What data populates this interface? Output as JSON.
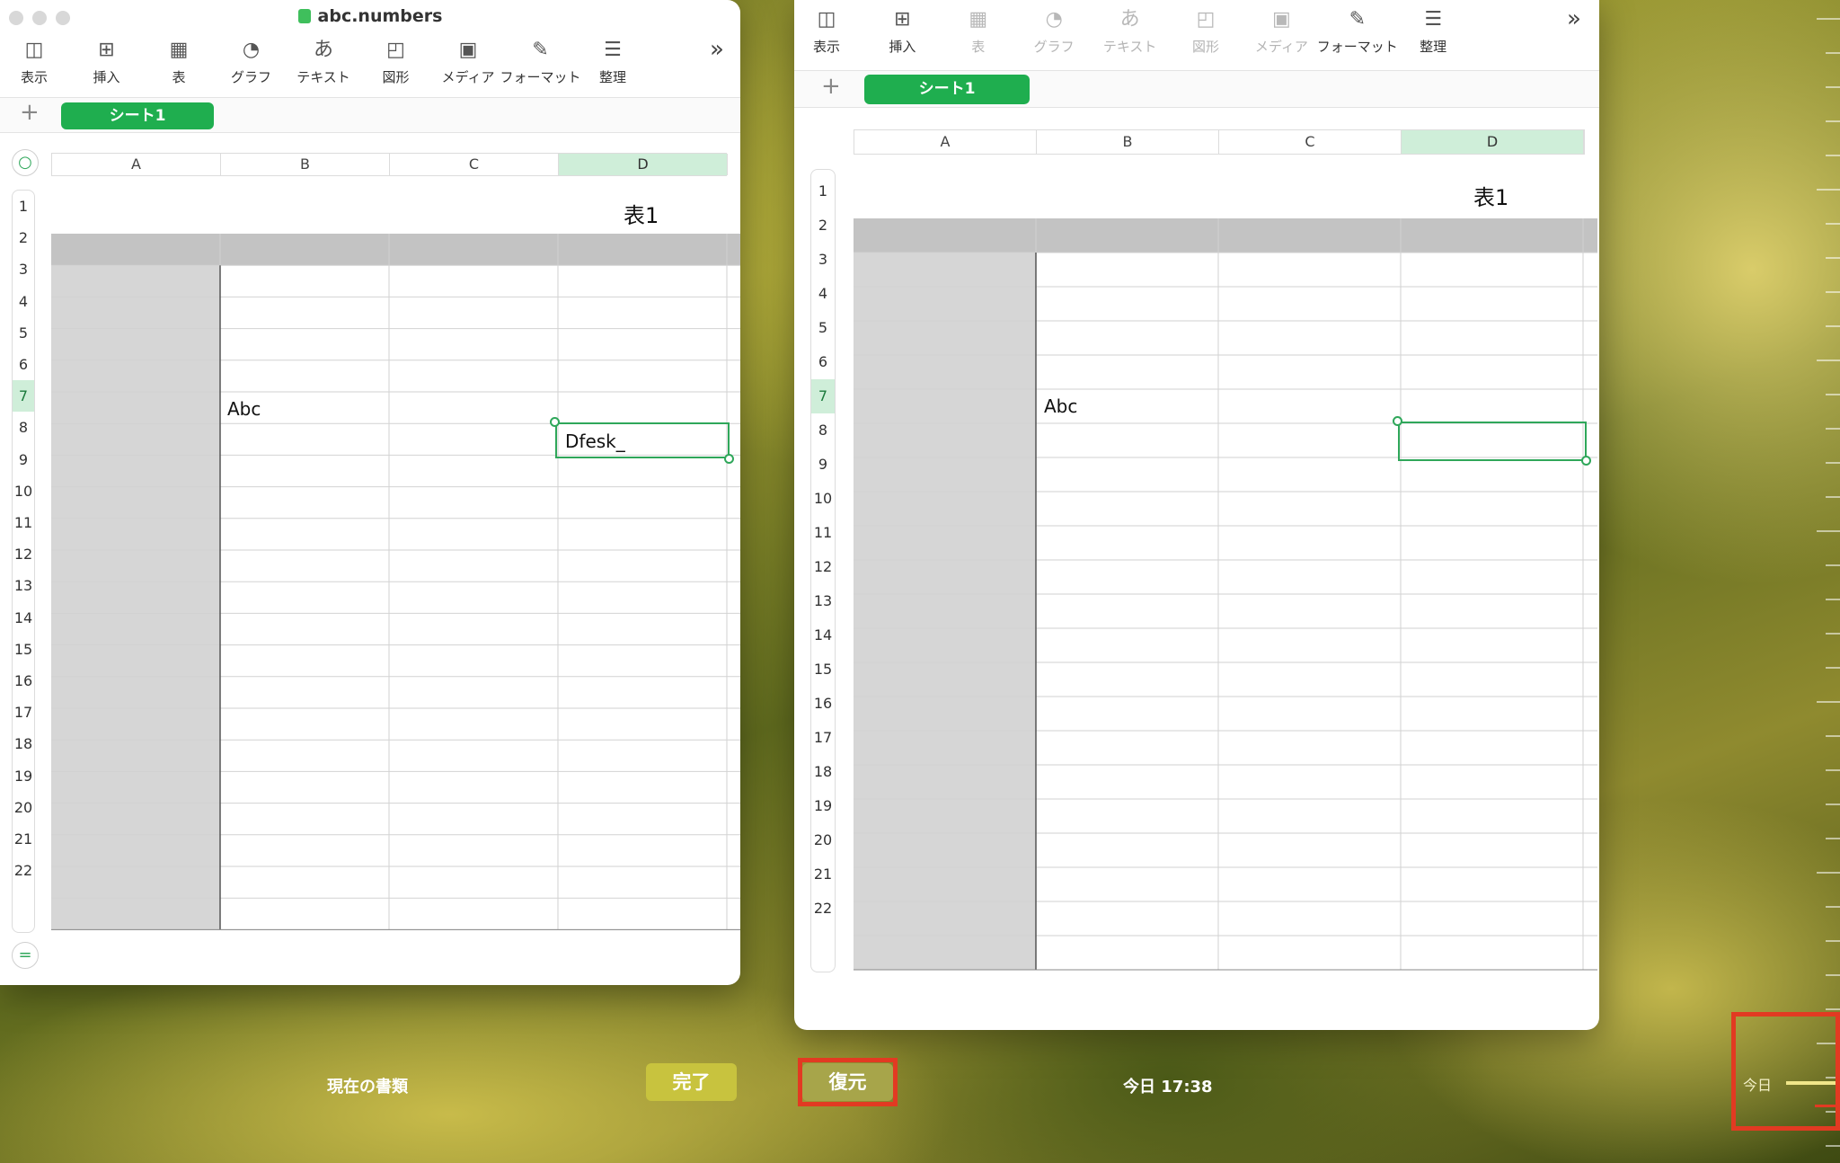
{
  "left_window": {
    "title": "abc.numbers",
    "toolbar": [
      {
        "icon": "sidebar-icon",
        "glyph": "◫",
        "label": "表示"
      },
      {
        "icon": "insert-icon",
        "glyph": "⊞",
        "label": "挿入"
      },
      {
        "icon": "table-icon",
        "glyph": "▦",
        "label": "表"
      },
      {
        "icon": "chart-icon",
        "glyph": "◔",
        "label": "グラフ"
      },
      {
        "icon": "text-icon",
        "glyph": "あ",
        "label": "テキスト"
      },
      {
        "icon": "shape-icon",
        "glyph": "◰",
        "label": "図形"
      },
      {
        "icon": "media-icon",
        "glyph": "▣",
        "label": "メディア"
      },
      {
        "icon": "format-icon",
        "glyph": "✎",
        "label": "フォーマット"
      },
      {
        "icon": "organize-icon",
        "glyph": "☰",
        "label": "整理"
      }
    ],
    "more_glyph": "»",
    "add_sheet_glyph": "+",
    "sheet_tab": "シート1",
    "columns": [
      "A",
      "B",
      "C",
      "D"
    ],
    "selected_column": "D",
    "rows": [
      "1",
      "2",
      "3",
      "4",
      "5",
      "6",
      "7",
      "8",
      "9",
      "10",
      "11",
      "12",
      "13",
      "14",
      "15",
      "16",
      "17",
      "18",
      "19",
      "20",
      "21",
      "22"
    ],
    "selected_row": "7",
    "table_title": "表1",
    "cell_b6": "Abc",
    "cell_d7": "Dfesk_"
  },
  "right_window": {
    "toolbar": [
      {
        "icon": "sidebar-icon",
        "glyph": "◫",
        "label": "表示",
        "enabled": true
      },
      {
        "icon": "insert-icon",
        "glyph": "⊞",
        "label": "挿入",
        "enabled": true
      },
      {
        "icon": "table-icon",
        "glyph": "▦",
        "label": "表",
        "enabled": false
      },
      {
        "icon": "chart-icon",
        "glyph": "◔",
        "label": "グラフ",
        "enabled": false
      },
      {
        "icon": "text-icon",
        "glyph": "あ",
        "label": "テキスト",
        "enabled": false
      },
      {
        "icon": "shape-icon",
        "glyph": "◰",
        "label": "図形",
        "enabled": false
      },
      {
        "icon": "media-icon",
        "glyph": "▣",
        "label": "メディア",
        "enabled": false
      },
      {
        "icon": "format-icon",
        "glyph": "✎",
        "label": "フォーマット",
        "enabled": true
      },
      {
        "icon": "organize-icon",
        "glyph": "☰",
        "label": "整理",
        "enabled": true
      }
    ],
    "more_glyph": "»",
    "add_sheet_glyph": "+",
    "sheet_tab": "シート1",
    "columns": [
      "A",
      "B",
      "C",
      "D"
    ],
    "selected_column": "D",
    "rows": [
      "1",
      "2",
      "3",
      "4",
      "5",
      "6",
      "7",
      "8",
      "9",
      "10",
      "11",
      "12",
      "13",
      "14",
      "15",
      "16",
      "17",
      "18",
      "19",
      "20",
      "21",
      "22"
    ],
    "selected_row": "7",
    "table_title": "表1",
    "cell_b6": "Abc"
  },
  "bottom": {
    "current_doc_label": "現在の書類",
    "done_button": "完了",
    "restore_button": "復元",
    "version_time": "今日 17:38",
    "timeline_today": "今日"
  },
  "colors": {
    "accent_green": "#1fae4f",
    "selection_green": "#2fa75a",
    "highlight_red": "#e23a22",
    "done_button_bg": "#c8c33e"
  }
}
